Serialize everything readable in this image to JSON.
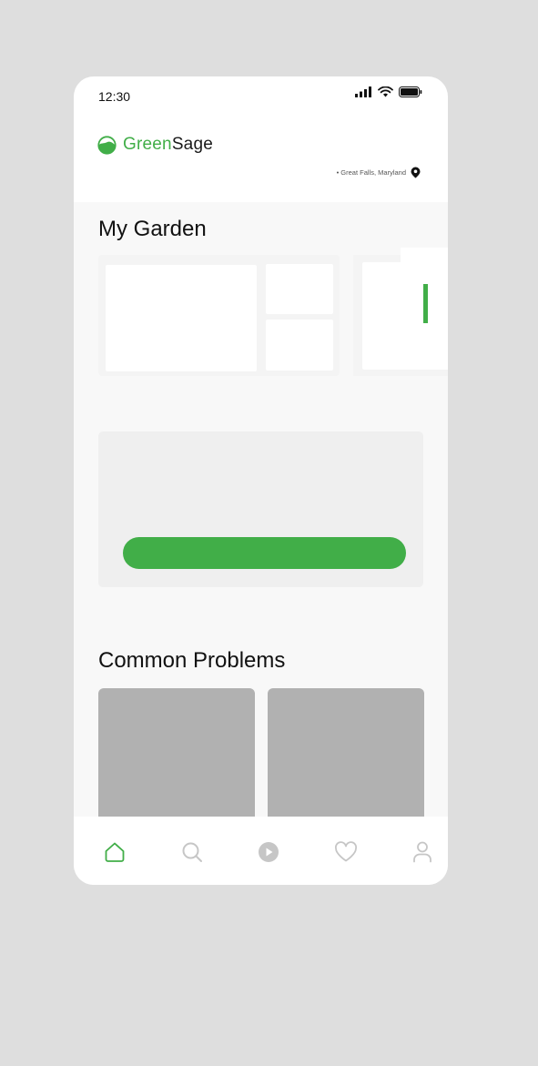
{
  "status_bar": {
    "time": "12:30",
    "icons": [
      "signal-icon",
      "wifi-icon",
      "battery-icon"
    ]
  },
  "header": {
    "brand_part1": "Green",
    "brand_part2": "Sage",
    "location": "• Great Falls, Maryland",
    "icons": [
      "logo-icon",
      "location-pin-icon"
    ]
  },
  "garden": {
    "title": "My Garden"
  },
  "promo": {
    "button_label": ""
  },
  "problems": {
    "title": "Common Problems"
  },
  "bottom_nav": {
    "items": [
      {
        "name": "home",
        "icon": "home-icon",
        "active": true
      },
      {
        "name": "search",
        "icon": "search-icon",
        "active": false
      },
      {
        "name": "play",
        "icon": "play-icon",
        "active": false
      },
      {
        "name": "favorites",
        "icon": "heart-icon",
        "active": false
      },
      {
        "name": "profile",
        "icon": "profile-icon",
        "active": false
      }
    ]
  },
  "colors": {
    "accent": "#41ae48",
    "background": "#dedede",
    "surface": "#f8f8f8",
    "placeholder_gray": "#b1b1b1",
    "inactive_icon": "#c6c6c6"
  }
}
